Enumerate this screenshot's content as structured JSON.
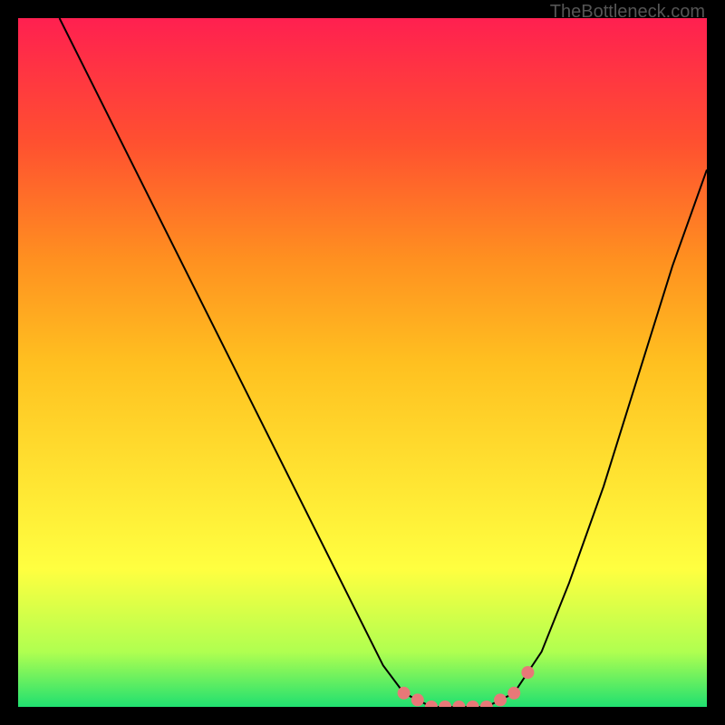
{
  "watermark": "TheBottleneck.com",
  "chart_data": {
    "type": "line",
    "title": "",
    "xlabel": "",
    "ylabel": "",
    "xlim": [
      0,
      100
    ],
    "ylim": [
      0,
      100
    ],
    "series": [
      {
        "name": "curve",
        "x": [
          6,
          10,
          15,
          20,
          25,
          30,
          35,
          40,
          45,
          50,
          53,
          56,
          60,
          64,
          68,
          72,
          76,
          80,
          85,
          90,
          95,
          100
        ],
        "y": [
          100,
          92,
          82,
          72,
          62,
          52,
          42,
          32,
          22,
          12,
          6,
          2,
          0,
          0,
          0,
          2,
          8,
          18,
          32,
          48,
          64,
          78
        ]
      }
    ],
    "markers": {
      "name": "highlight-dots",
      "color": "#e87878",
      "x": [
        56,
        58,
        60,
        62,
        64,
        66,
        68,
        70,
        72,
        74
      ],
      "y": [
        2,
        1,
        0,
        0,
        0,
        0,
        0,
        1,
        2,
        5
      ]
    },
    "gradient_stops": [
      {
        "pos": 0,
        "color": "#ff2050"
      },
      {
        "pos": 50,
        "color": "#ffe030"
      },
      {
        "pos": 100,
        "color": "#20e070"
      }
    ]
  }
}
